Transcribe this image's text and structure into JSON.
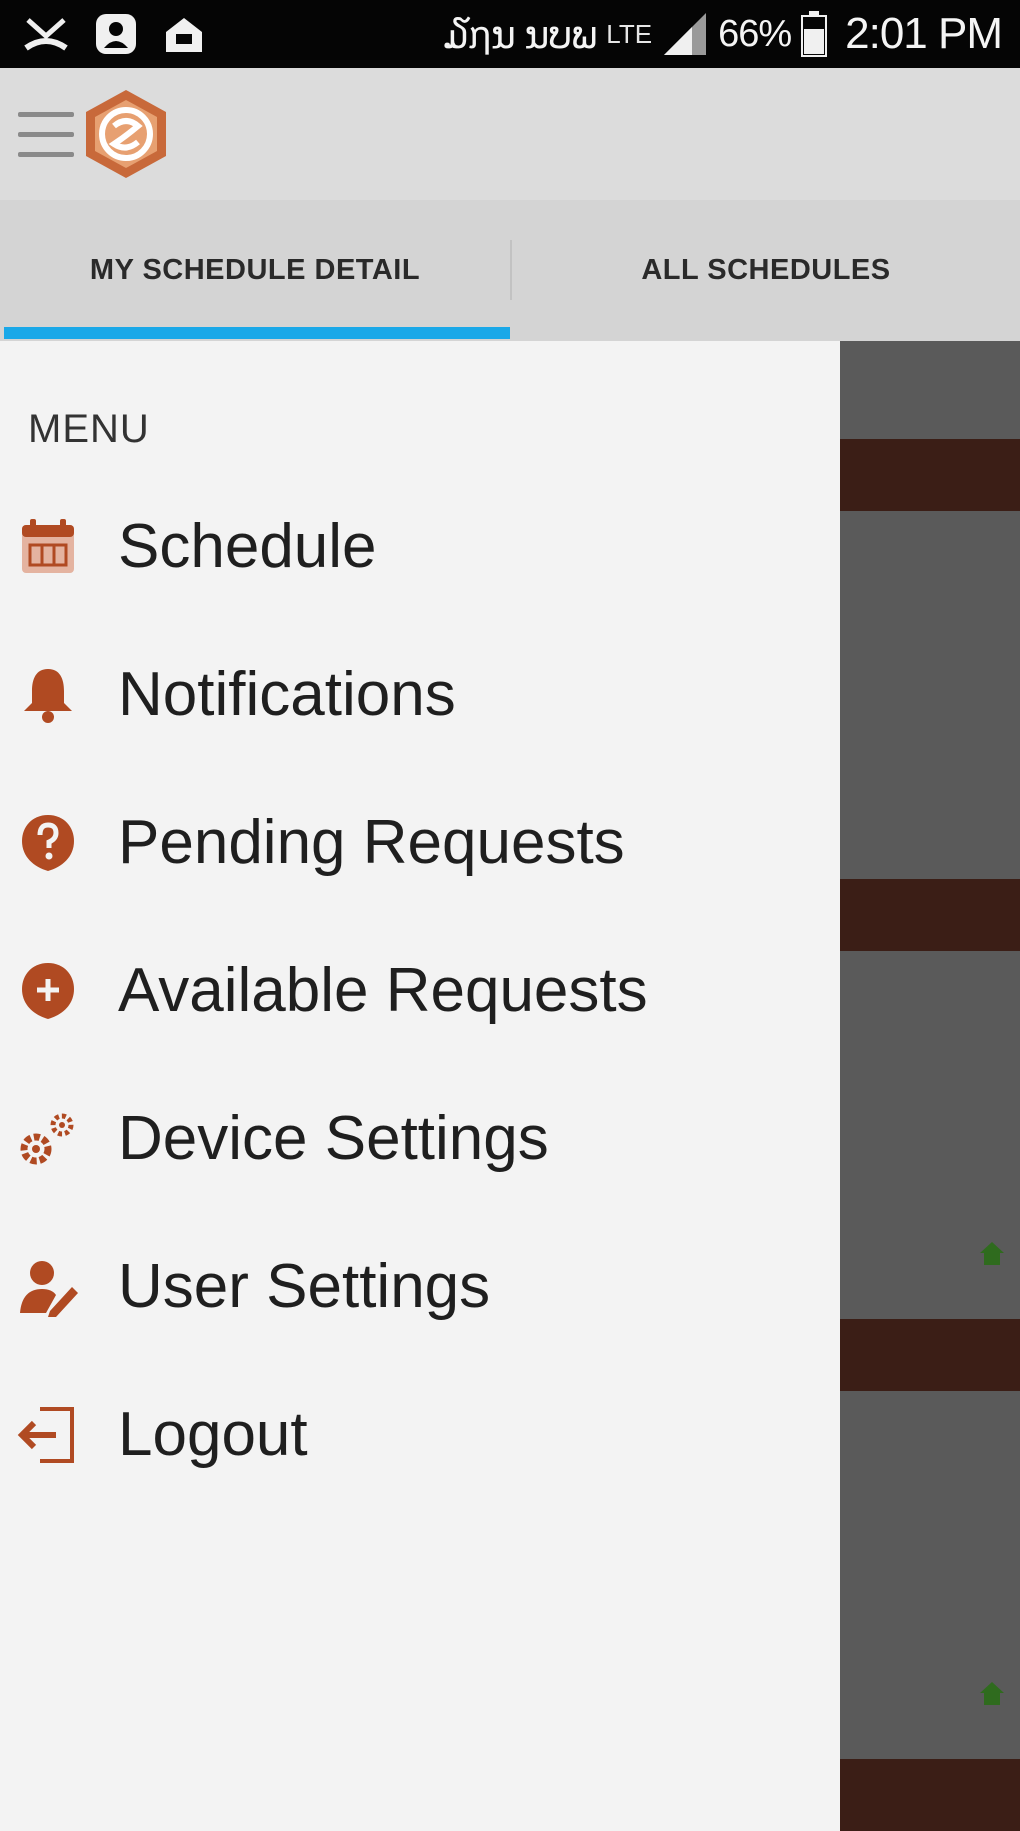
{
  "status_bar": {
    "carrier_indicators": "໓ຐນ ນບພ",
    "lte_label": "LTE",
    "battery": "66%",
    "time": "2:01 PM"
  },
  "tabs": [
    {
      "label": "MY SCHEDULE DETAIL",
      "active": true
    },
    {
      "label": "ALL SCHEDULES",
      "active": false
    }
  ],
  "menu": {
    "title": "MENU",
    "items": [
      {
        "label": "Schedule",
        "icon": "calendar-icon"
      },
      {
        "label": "Notifications",
        "icon": "bell-icon"
      },
      {
        "label": "Pending Requests",
        "icon": "question-badge-icon"
      },
      {
        "label": "Available Requests",
        "icon": "plus-badge-icon"
      },
      {
        "label": "Device Settings",
        "icon": "gears-icon"
      },
      {
        "label": "User Settings",
        "icon": "user-edit-icon"
      },
      {
        "label": "Logout",
        "icon": "logout-icon"
      }
    ]
  },
  "colors": {
    "accent": "#1aa8e8",
    "icon": "#b04a22",
    "brand": "#c8693a"
  }
}
